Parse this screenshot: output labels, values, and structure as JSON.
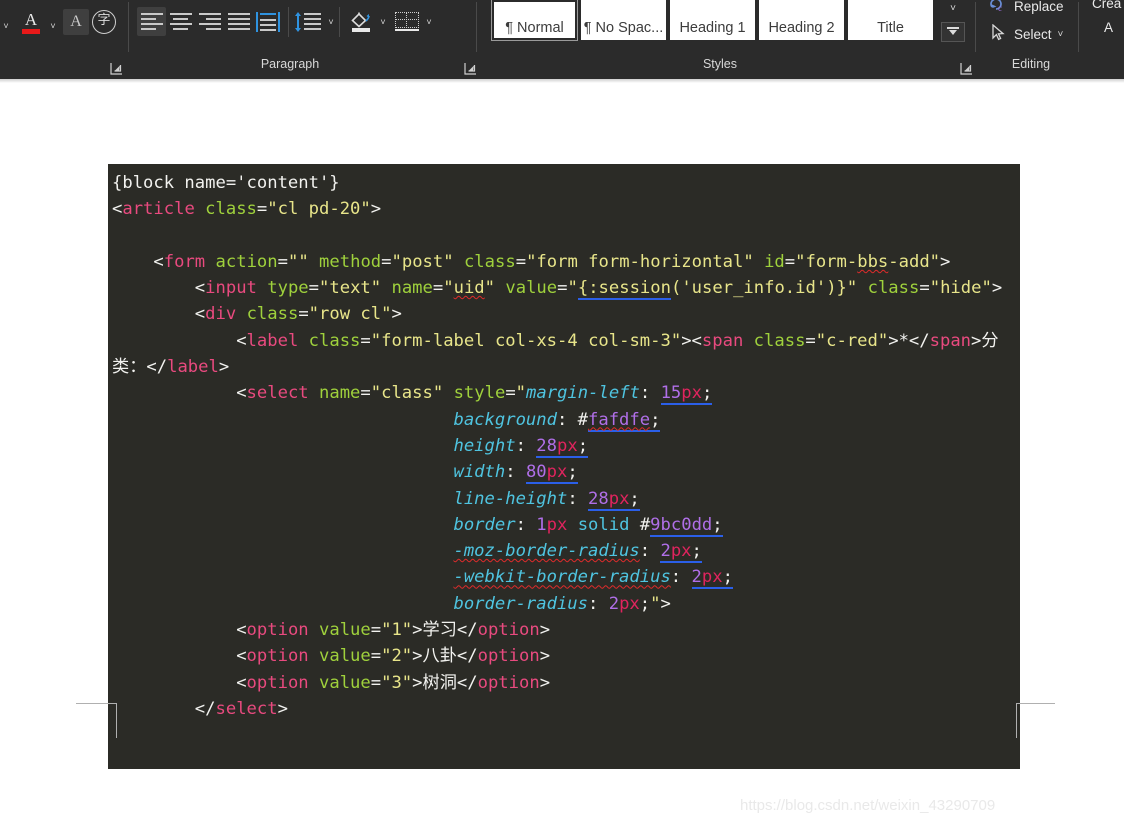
{
  "ribbon": {
    "groups": [
      {
        "name": "paragraph",
        "label": "Paragraph"
      },
      {
        "name": "styles",
        "label": "Styles"
      },
      {
        "name": "editing",
        "label": "Editing"
      }
    ],
    "font_group": {
      "font_color_icon": "font-color-icon",
      "font_color_chevron": "˅",
      "text_effects_icon": "text-effects-icon",
      "phonetic_guide_icon": "phonetic-guide-icon",
      "phonetic_guide_glyph": "字",
      "leading_chevron": "˅"
    },
    "paragraph_group": {
      "align_left": "align-left",
      "align_center": "align-center",
      "align_right": "align-right",
      "justify": "justify",
      "distributed": "distributed",
      "line_spacing": "line-spacing",
      "shading": "shading",
      "borders": "borders",
      "chevron": "˅"
    },
    "styles_group": {
      "items": [
        {
          "label": "¶ Normal",
          "active": true
        },
        {
          "label": "¶ No Spac...",
          "active": false
        },
        {
          "label": "Heading 1",
          "active": false
        },
        {
          "label": "Heading 2",
          "active": false
        },
        {
          "label": "Title",
          "active": false
        }
      ],
      "scroll_up": "˄",
      "scroll_down": "˅",
      "more": "˅"
    },
    "editing_group": {
      "replace_label": "Replace",
      "replace_icon": "replace-icon",
      "select_label": "Select",
      "select_icon": "select-cursor-icon",
      "select_chevron": "˅"
    },
    "far_right": {
      "line1": "Crea",
      "line2": "A"
    }
  },
  "document": {
    "watermark": "https://blog.csdn.net/weixin_43290709"
  },
  "code_block": {
    "language": "html",
    "background": "#2b2b26",
    "colors": {
      "plain": "#f2f2ef",
      "tag": "#e94a7f",
      "attribute": "#9fd13c",
      "value": "#e8e58a",
      "css_property": "#4fc4e0",
      "number": "#b06fe8",
      "unit": "#e0245e",
      "spellcheck_underline": "#e02b2b",
      "grammar_underline": "#2b5fe8"
    },
    "lines": [
      "{block name='content'}",
      "<article class=\"cl pd-20\">",
      "",
      "    <form action=\"\" method=\"post\" class=\"form form-horizontal\" id=\"form-bbs-add\">",
      "        <input type=\"text\" name=\"uid\" value=\"{:session('user_info.id')}\" class=\"hide\">",
      "        <div class=\"row cl\">",
      "            <label class=\"form-label col-xs-4 col-sm-3\"><span class=\"c-red\">*</span>分类：</label>",
      "            <select name=\"class\" style=\"margin-left: 15px;",
      "                     background: #fafdfe;",
      "                     height: 28px;",
      "                     width: 80px;",
      "                     line-height: 28px;",
      "                     border: 1px solid #9bc0dd;",
      "                     -moz-border-radius: 2px;",
      "                     -webkit-border-radius: 2px;",
      "                     border-radius: 2px;\">",
      "            <option value=\"1\">学习</option>",
      "            <option value=\"2\">八卦</option>",
      "            <option value=\"3\">树洞</option>",
      "        </select>"
    ],
    "select_options": [
      {
        "value": "1",
        "text": "学习"
      },
      {
        "value": "2",
        "text": "八卦"
      },
      {
        "value": "3",
        "text": "树洞"
      }
    ],
    "inline_styles": [
      {
        "property": "margin-left",
        "value": "15px"
      },
      {
        "property": "background",
        "value": "#fafdfe"
      },
      {
        "property": "height",
        "value": "28px"
      },
      {
        "property": "width",
        "value": "80px"
      },
      {
        "property": "line-height",
        "value": "28px"
      },
      {
        "property": "border",
        "value": "1px solid #9bc0dd"
      },
      {
        "property": "-moz-border-radius",
        "value": "2px"
      },
      {
        "property": "-webkit-border-radius",
        "value": "2px"
      },
      {
        "property": "border-radius",
        "value": "2px"
      }
    ]
  }
}
